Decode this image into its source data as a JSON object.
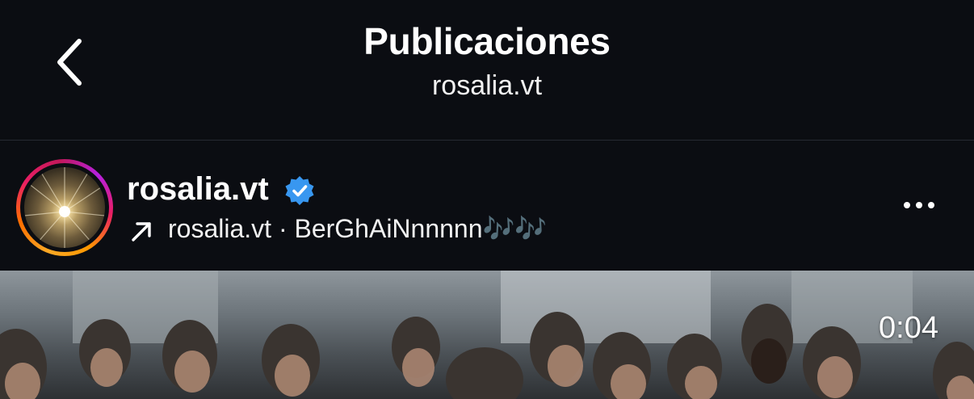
{
  "header": {
    "title": "Publicaciones",
    "subtitle": "rosalia.vt"
  },
  "post": {
    "username": "rosalia.vt",
    "verified": true,
    "audio_text": "rosalia.vt · BerGhAiNnnnnn🎶🎶",
    "video_duration": "0:04"
  },
  "icons": {
    "back": "chevron-left-icon",
    "verified": "verified-badge-icon",
    "audio": "arrow-up-right-icon",
    "more": "more-horizontal-icon"
  },
  "colors": {
    "background": "#0b0d12",
    "verified_blue": "#3897f0",
    "text": "#ffffff"
  }
}
